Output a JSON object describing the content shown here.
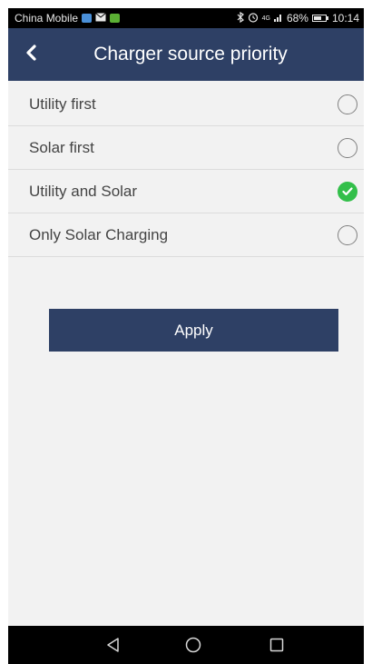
{
  "status_bar": {
    "carrier": "China Mobile",
    "signal_label": "4G",
    "battery_percent": "68%",
    "battery_level": 0.68,
    "time": "10:14",
    "icons": [
      "app-notification-icon",
      "mail-icon",
      "wechat-icon",
      "bluetooth-icon",
      "alarm-icon",
      "signal-icon",
      "battery-icon"
    ]
  },
  "header": {
    "back_icon": "chevron-left-icon",
    "title": "Charger source priority"
  },
  "options": [
    {
      "label": "Utility first",
      "selected": false
    },
    {
      "label": "Solar first",
      "selected": false
    },
    {
      "label": "Utility and Solar",
      "selected": true
    },
    {
      "label": "Only Solar Charging",
      "selected": false
    }
  ],
  "apply_label": "Apply",
  "nav_bar": {
    "icons": [
      "back-triangle-icon",
      "home-circle-icon",
      "recents-square-icon"
    ]
  },
  "colors": {
    "header_bg": "#2e4065",
    "selected_check": "#33bf4a",
    "page_bg": "#f2f2f2"
  }
}
